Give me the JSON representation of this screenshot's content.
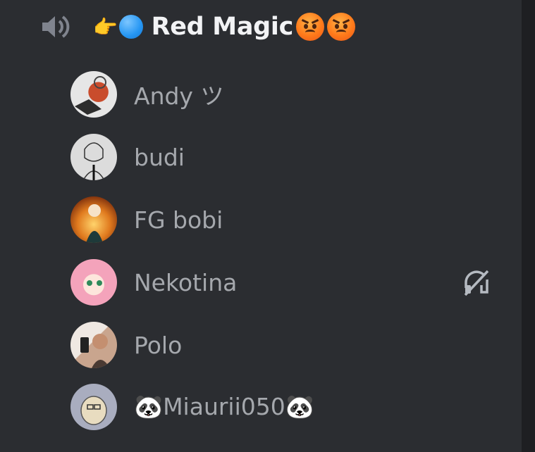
{
  "channel": {
    "speaker_icon": "speaker-icon",
    "prefix_emoji": "👉",
    "name": "Red Magic",
    "status_colors": {
      "dot": "#2596f3",
      "angry": "#ff7a1a"
    }
  },
  "users": [
    {
      "name": "Andy ツ",
      "avatar_color": "#c9c9c9",
      "muted": false
    },
    {
      "name": "budi",
      "avatar_color": "#d8d8d8",
      "muted": false
    },
    {
      "name": "FG bobi",
      "avatar_color": "#e08a2a",
      "muted": false
    },
    {
      "name": "Nekotina",
      "avatar_color": "#f2a7b9",
      "muted": true
    },
    {
      "name": "Polo",
      "avatar_color": "#b89984",
      "muted": false
    },
    {
      "name": "🐼Miaurii050🐼",
      "avatar_color": "#9ea2b8",
      "muted": false
    }
  ]
}
